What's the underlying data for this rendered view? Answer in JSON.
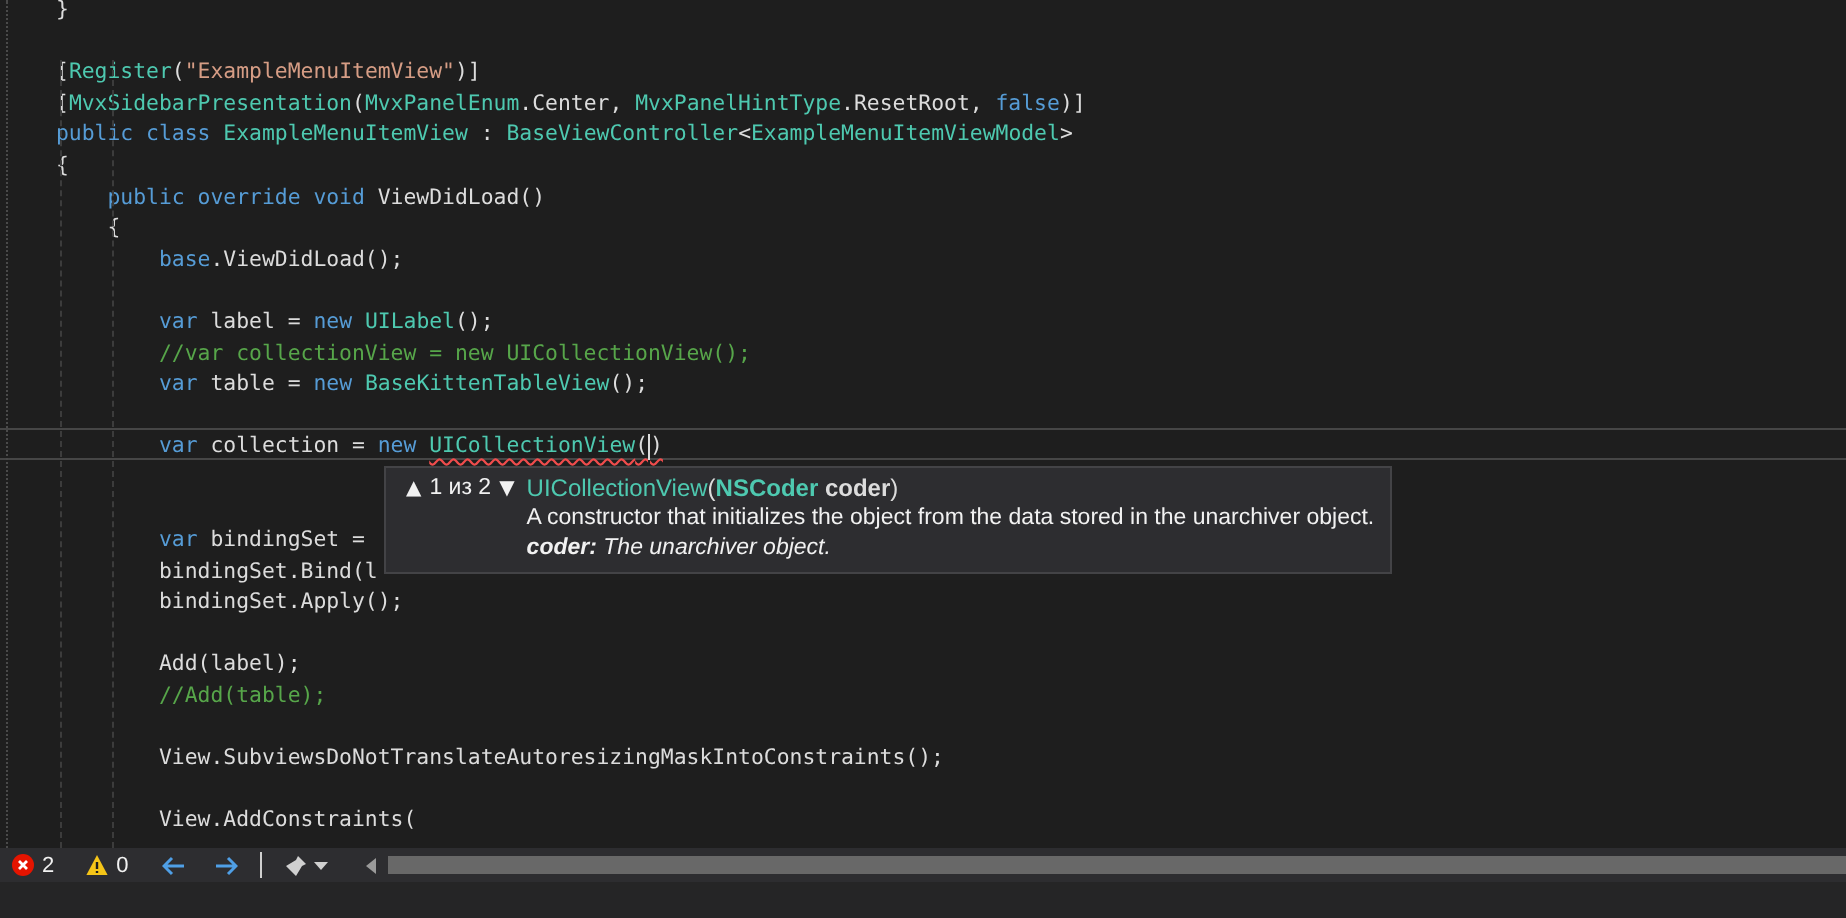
{
  "editor": {
    "lines": [
      {
        "kind": "code",
        "tokens": [
          {
            "kind": "plain",
            "text": "}"
          }
        ]
      },
      {
        "kind": "blank"
      },
      {
        "kind": "code",
        "tokens": [
          {
            "kind": "plain",
            "text": "["
          },
          {
            "kind": "type",
            "text": "Register"
          },
          {
            "kind": "plain",
            "text": "("
          },
          {
            "kind": "string",
            "text": "\"ExampleMenuItemView\""
          },
          {
            "kind": "plain",
            "text": ")]"
          }
        ]
      },
      {
        "kind": "code",
        "tokens": [
          {
            "kind": "plain",
            "text": "["
          },
          {
            "kind": "type",
            "text": "MvxSidebarPresentation"
          },
          {
            "kind": "plain",
            "text": "("
          },
          {
            "kind": "type",
            "text": "MvxPanelEnum"
          },
          {
            "kind": "plain",
            "text": ".Center, "
          },
          {
            "kind": "type",
            "text": "MvxPanelHintType"
          },
          {
            "kind": "plain",
            "text": ".ResetRoot, "
          },
          {
            "kind": "keyword",
            "text": "false"
          },
          {
            "kind": "plain",
            "text": ")]"
          }
        ]
      },
      {
        "kind": "code",
        "tokens": [
          {
            "kind": "keyword",
            "text": "public class "
          },
          {
            "kind": "type",
            "text": "ExampleMenuItemView"
          },
          {
            "kind": "plain",
            "text": " : "
          },
          {
            "kind": "type",
            "text": "BaseViewController"
          },
          {
            "kind": "plain",
            "text": "<"
          },
          {
            "kind": "type",
            "text": "ExampleMenuItemViewModel"
          },
          {
            "kind": "plain",
            "text": ">"
          }
        ]
      },
      {
        "kind": "code",
        "tokens": [
          {
            "kind": "plain",
            "text": "{"
          }
        ]
      },
      {
        "kind": "code",
        "tokens": [
          {
            "kind": "keyword",
            "text": "    public override void "
          },
          {
            "kind": "plain",
            "text": "ViewDidLoad()"
          }
        ]
      },
      {
        "kind": "code",
        "tokens": [
          {
            "kind": "plain",
            "text": "    {"
          }
        ]
      },
      {
        "kind": "code",
        "tokens": [
          {
            "kind": "keyword",
            "text": "        base"
          },
          {
            "kind": "plain",
            "text": ".ViewDidLoad();"
          }
        ]
      },
      {
        "kind": "blank"
      },
      {
        "kind": "code",
        "tokens": [
          {
            "kind": "keyword",
            "text": "        var "
          },
          {
            "kind": "plain",
            "text": "label = "
          },
          {
            "kind": "keyword",
            "text": "new "
          },
          {
            "kind": "type",
            "text": "UILabel"
          },
          {
            "kind": "plain",
            "text": "();"
          }
        ]
      },
      {
        "kind": "code",
        "tokens": [
          {
            "kind": "comment",
            "text": "        //var collectionView = new UICollectionView();"
          }
        ]
      },
      {
        "kind": "code",
        "tokens": [
          {
            "kind": "keyword",
            "text": "        var "
          },
          {
            "kind": "plain",
            "text": "table = "
          },
          {
            "kind": "keyword",
            "text": "new "
          },
          {
            "kind": "type",
            "text": "BaseKittenTableView"
          },
          {
            "kind": "plain",
            "text": "();"
          }
        ]
      },
      {
        "kind": "blank"
      },
      {
        "kind": "code",
        "current": true,
        "tokens": [
          {
            "kind": "keyword",
            "text": "        var "
          },
          {
            "kind": "plain",
            "text": "collection = "
          },
          {
            "kind": "keyword",
            "text": "new "
          },
          {
            "kind": "type",
            "text": "UICollectionView",
            "error": true
          },
          {
            "kind": "plain",
            "text": "(",
            "error": true
          },
          {
            "kind": "caret"
          },
          {
            "kind": "plain",
            "text": ")",
            "error": true
          }
        ]
      },
      {
        "kind": "blank"
      },
      {
        "kind": "blank"
      },
      {
        "kind": "code",
        "tokens": [
          {
            "kind": "keyword",
            "text": "        var "
          },
          {
            "kind": "plain",
            "text": "bindingSet = "
          }
        ]
      },
      {
        "kind": "code",
        "tokens": [
          {
            "kind": "plain",
            "text": "        bindingSet.Bind(l"
          }
        ]
      },
      {
        "kind": "code",
        "tokens": [
          {
            "kind": "plain",
            "text": "        bindingSet.Apply();"
          }
        ]
      },
      {
        "kind": "blank"
      },
      {
        "kind": "code",
        "tokens": [
          {
            "kind": "plain",
            "text": "        Add(label);"
          }
        ]
      },
      {
        "kind": "code",
        "tokens": [
          {
            "kind": "comment",
            "text": "        //Add(table);"
          }
        ]
      },
      {
        "kind": "blank"
      },
      {
        "kind": "code",
        "tokens": [
          {
            "kind": "plain",
            "text": "        View.SubviewsDoNotTranslateAutoresizingMaskIntoConstraints();"
          }
        ]
      },
      {
        "kind": "blank"
      },
      {
        "kind": "code",
        "tokens": [
          {
            "kind": "plain",
            "text": "        View.AddConstraints("
          }
        ]
      }
    ]
  },
  "signature_help": {
    "previous": "▲",
    "counter": "1 из 2",
    "next": "▼",
    "signature": [
      {
        "kind": "type",
        "text": "UICollectionView"
      },
      {
        "kind": "plain",
        "text": "("
      },
      {
        "kind": "type",
        "text": "NSCoder",
        "bold": true
      },
      {
        "kind": "plain",
        "text": " coder",
        "bold": true
      },
      {
        "kind": "plain",
        "text": ")"
      }
    ],
    "description": "A constructor that initializes the object from the data stored in the unarchiver object.",
    "parameter": "**coder:** The unarchiver object."
  },
  "status_bar": {
    "errors": "2",
    "warnings": "0"
  }
}
